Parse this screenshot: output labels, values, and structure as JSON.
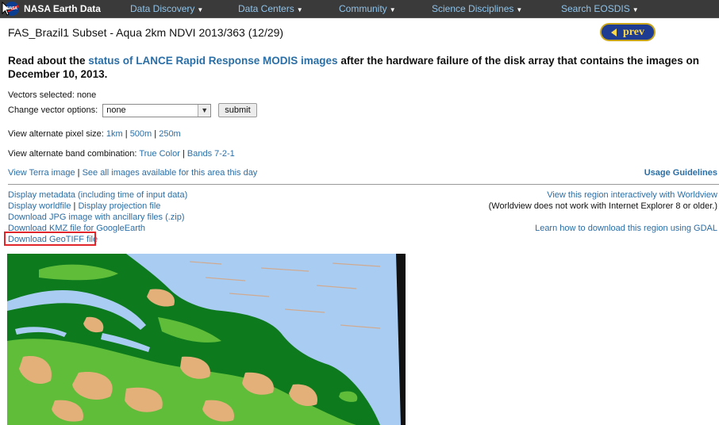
{
  "nav": {
    "brand": "NASA Earth Data",
    "logo_text": "NASA",
    "items": [
      {
        "label": "Data Discovery"
      },
      {
        "label": "Data Centers"
      },
      {
        "label": "Community"
      },
      {
        "label": "Science Disciplines"
      },
      {
        "label": "Search EOSDIS"
      }
    ]
  },
  "page": {
    "title": "FAS_Brazil1 Subset - Aqua 2km NDVI 2013/363 (12/29)",
    "prev_label": "prev",
    "notice_before": "Read about the ",
    "notice_link": "status of LANCE Rapid Response MODIS images",
    "notice_after": " after the hardware failure of the disk array that contains the images on December 10, 2013."
  },
  "vectors": {
    "selected_label": "Vectors selected: none",
    "change_label": "Change vector options:",
    "select_value": "none",
    "submit_label": "submit"
  },
  "pixel_size": {
    "label": "View alternate pixel size: ",
    "options": [
      "1km",
      "500m",
      "250m"
    ]
  },
  "band": {
    "label": "View alternate band combination: ",
    "options": [
      "True Color",
      "Bands 7-2-1"
    ]
  },
  "links_row": {
    "terra": "View Terra image",
    "all_images": "See all images available for this area this day",
    "usage": "Usage Guidelines"
  },
  "downloads": {
    "metadata": "Display metadata (including time of input data)",
    "worldfile": "Display worldfile",
    "projection": "Display projection file",
    "jpg": "Download JPG image with ancillary files (.zip)",
    "kmz": "Download KMZ file for GoogleEarth",
    "geotiff": "Download GeoTIFF file"
  },
  "worldview": {
    "link": "View this region interactively with Worldview",
    "note": "(Worldview does not work with Internet Explorer 8 or older.)",
    "gdal": "Learn how to download this region using GDAL"
  },
  "colors": {
    "nav_bg": "#3a3a3a",
    "link": "#2a6ea6",
    "water": "#a9cdf2",
    "forest": "#0e7a1e",
    "grass": "#5fbd3a",
    "bare": "#e3b07a",
    "highlight": "#e0262a"
  }
}
